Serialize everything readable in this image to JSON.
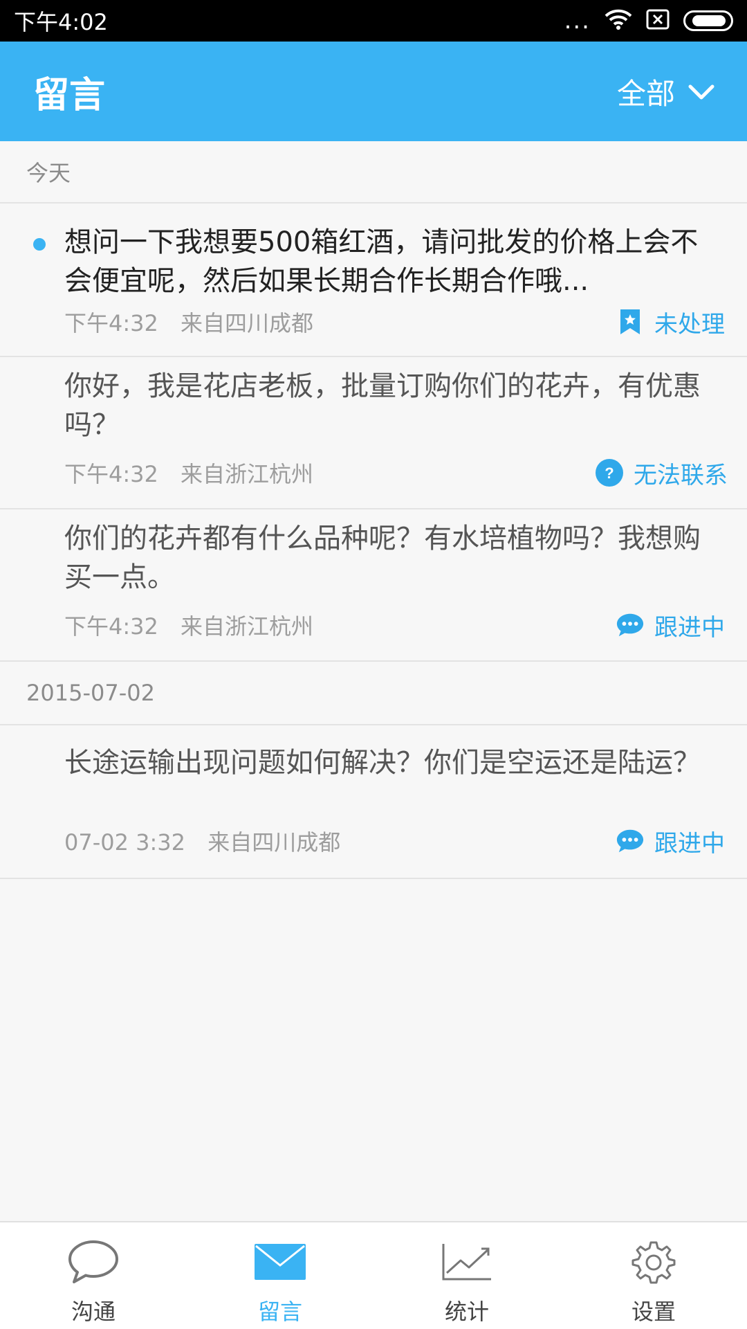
{
  "status_bar": {
    "time": "下午4:02",
    "dots": "..."
  },
  "header": {
    "title": "留言",
    "filter_label": "全部"
  },
  "sections": [
    {
      "title": "今天",
      "messages": [
        {
          "text": "想问一下我想要500箱红酒，请问批发的价格上会不会便宜呢，然后如果长期合作长期合作哦...",
          "time": "下午4:32",
          "location": "来自四川成都",
          "status": "未处理",
          "status_icon": "bookmark-star-icon",
          "unread": true
        },
        {
          "text": "你好，我是花店老板，批量订购你们的花卉，有优惠吗？",
          "time": "下午4:32",
          "location": "来自浙江杭州",
          "status": "无法联系",
          "status_icon": "question-icon",
          "unread": false
        },
        {
          "text": "你们的花卉都有什么品种呢？有水培植物吗？我想购买一点。",
          "time": "下午4:32",
          "location": "来自浙江杭州",
          "status": "跟进中",
          "status_icon": "chat-bubble-icon",
          "unread": false
        }
      ]
    },
    {
      "title": "2015-07-02",
      "messages": [
        {
          "text": "长途运输出现问题如何解决？你们是空运还是陆运？",
          "time": "07-02 3:32",
          "location": "来自四川成都",
          "status": "跟进中",
          "status_icon": "chat-bubble-icon",
          "unread": false
        }
      ]
    }
  ],
  "tabs": [
    {
      "label": "沟通",
      "icon": "chat-icon",
      "active": false
    },
    {
      "label": "留言",
      "icon": "mail-icon",
      "active": true
    },
    {
      "label": "统计",
      "icon": "chart-icon",
      "active": false
    },
    {
      "label": "设置",
      "icon": "gear-icon",
      "active": false
    }
  ],
  "colors": {
    "accent": "#3ab3f3",
    "status_blue": "#2fa8ea",
    "background": "#f7f7f7"
  }
}
